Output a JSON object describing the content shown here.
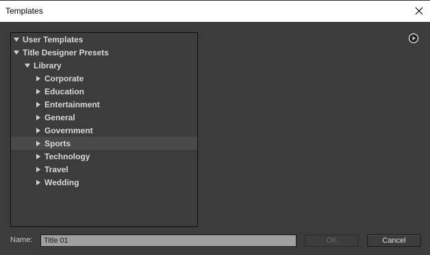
{
  "window": {
    "title": "Templates"
  },
  "tree": {
    "items": [
      {
        "label": "User Templates",
        "level": 0,
        "expanded": true,
        "selected": false
      },
      {
        "label": "Title Designer Presets",
        "level": 0,
        "expanded": true,
        "selected": false
      },
      {
        "label": "Library",
        "level": 1,
        "expanded": true,
        "selected": false
      },
      {
        "label": "Corporate",
        "level": 2,
        "expanded": false,
        "selected": false
      },
      {
        "label": "Education",
        "level": 2,
        "expanded": false,
        "selected": false
      },
      {
        "label": "Entertainment",
        "level": 2,
        "expanded": false,
        "selected": false
      },
      {
        "label": "General",
        "level": 2,
        "expanded": false,
        "selected": false
      },
      {
        "label": "Government",
        "level": 2,
        "expanded": false,
        "selected": false
      },
      {
        "label": "Sports",
        "level": 2,
        "expanded": false,
        "selected": true
      },
      {
        "label": "Technology",
        "level": 2,
        "expanded": false,
        "selected": false
      },
      {
        "label": "Travel",
        "level": 2,
        "expanded": false,
        "selected": false
      },
      {
        "label": "Wedding",
        "level": 2,
        "expanded": false,
        "selected": false
      }
    ]
  },
  "name_field": {
    "label": "Name:",
    "value": "Title 01"
  },
  "buttons": {
    "ok_label": "OK",
    "cancel_label": "Cancel",
    "ok_enabled": false
  },
  "icons": {
    "close": "close-icon",
    "panel_menu": "flyout-menu-icon",
    "expanded": "triangle-down-icon",
    "collapsed": "triangle-right-icon"
  },
  "colors": {
    "background": "#3c3c3c",
    "selected_row": "#4a4a4a",
    "text": "#d9d9d9",
    "input_bg": "#a0a0a0"
  }
}
